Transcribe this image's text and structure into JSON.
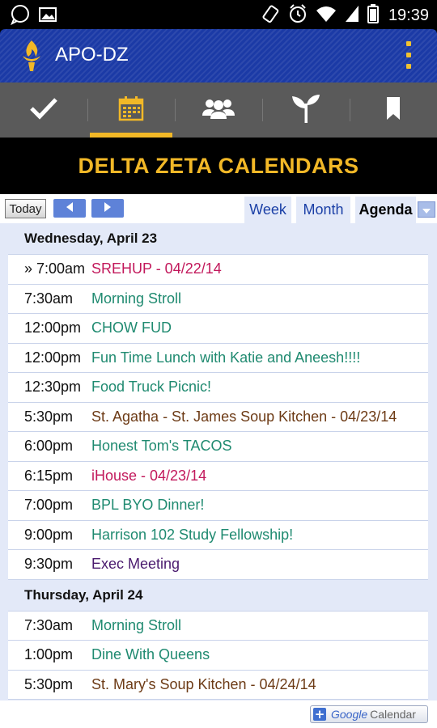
{
  "status_bar": {
    "time": "19:39"
  },
  "app_bar": {
    "title": "APO-DZ",
    "logo_icon": "torch-icon"
  },
  "tabs": [
    {
      "name": "tab-tasks",
      "icon": "checkmark-icon"
    },
    {
      "name": "tab-calendar",
      "icon": "calendar-icon",
      "active": true
    },
    {
      "name": "tab-members",
      "icon": "people-icon"
    },
    {
      "name": "tab-growth",
      "icon": "sprout-icon"
    },
    {
      "name": "tab-bookmarks",
      "icon": "bookmark-icon"
    }
  ],
  "calendar": {
    "title": "DELTA ZETA CALENDARS",
    "today_label": "Today",
    "views": {
      "week": "Week",
      "month": "Month",
      "agenda": "Agenda"
    }
  },
  "agenda": {
    "days": [
      {
        "label": "Wednesday, April 23",
        "events": [
          {
            "time": "» 7:00am",
            "title": "SREHUP - 04/22/14",
            "color": "#c2185b"
          },
          {
            "time": "7:30am",
            "title": "Morning Stroll",
            "color": "#1f8a70"
          },
          {
            "time": "12:00pm",
            "title": "CHOW FUD",
            "color": "#1f8a70"
          },
          {
            "time": "12:00pm",
            "title": "Fun Time Lunch with Katie and Aneesh!!!!",
            "color": "#1f8a70"
          },
          {
            "time": "12:30pm",
            "title": "Food Truck Picnic!",
            "color": "#1f8a70"
          },
          {
            "time": "5:30pm",
            "title": "St. Agatha - St. James Soup Kitchen - 04/23/14",
            "color": "#6d3b16"
          },
          {
            "time": "6:00pm",
            "title": "Honest Tom's TACOS",
            "color": "#1f8a70"
          },
          {
            "time": "6:15pm",
            "title": "iHouse - 04/23/14",
            "color": "#c2185b"
          },
          {
            "time": "7:00pm",
            "title": "BPL BYO Dinner!",
            "color": "#1f8a70"
          },
          {
            "time": "9:00pm",
            "title": "Harrison 102 Study Fellowship!",
            "color": "#1f8a70"
          },
          {
            "time": "9:30pm",
            "title": "Exec Meeting",
            "color": "#4a1a6e"
          }
        ]
      },
      {
        "label": "Thursday, April 24",
        "events": [
          {
            "time": "7:30am",
            "title": "Morning Stroll",
            "color": "#1f8a70"
          },
          {
            "time": "1:00pm",
            "title": "Dine With Queens",
            "color": "#1f8a70"
          },
          {
            "time": "5:30pm",
            "title": "St. Mary's Soup Kitchen - 04/24/14",
            "color": "#6d3b16"
          }
        ]
      }
    ]
  },
  "google_calendar_badge": {
    "google": "Google",
    "calendar": "Calendar"
  },
  "colors": {
    "app_bar": "#1b3aa6",
    "accent": "#f2b827",
    "tab_bar": "#5a5a5a"
  }
}
